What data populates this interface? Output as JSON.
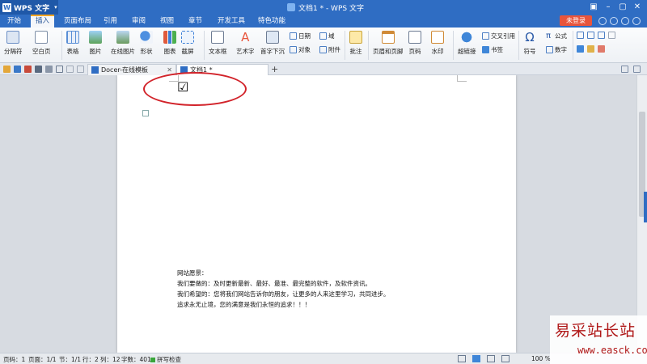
{
  "app": {
    "name": "WPS 文字",
    "window_title": "文档1 * - WPS 文字"
  },
  "menu_tabs": [
    "开始",
    "插入",
    "页面布局",
    "引用",
    "审阅",
    "视图",
    "章节",
    "开发工具",
    "特色功能"
  ],
  "active_tab": "插入",
  "login_button": "未登录",
  "ribbon": {
    "page_break": "分隔符",
    "blank_page": "空白页",
    "table": "表格",
    "picture": "图片",
    "online_picture": "在线图片",
    "shape": "形状",
    "chart": "图表",
    "screenshot": "截屏",
    "textbox": "文本框",
    "wordart": "艺术字",
    "dropcap": "首字下沉",
    "date": "日期",
    "field": "域",
    "object": "对象",
    "attachment": "附件",
    "comment": "批注",
    "header_footer": "页眉和页脚",
    "page_number": "页码",
    "watermark": "水印",
    "hyperlink": "超链接",
    "cross_ref": "交叉引用",
    "bookmark": "书签",
    "symbol": "符号",
    "formula": "公式",
    "number": "数字"
  },
  "doc_tabs": [
    {
      "label": "Docer-在线模板"
    },
    {
      "label": "文档1 *"
    }
  ],
  "document": {
    "checkbox_glyph": "☑",
    "paragraphs": [
      "网站愿景：",
      "我们要做的：及时更新最新、最好、最准、最完整的软件，及软件资讯。",
      "我们希望的：您将我们网站告诉你的朋友，让更多的人来这里学习，共同进步。",
      "追求永无止境，您的满意是我们永恒的追求！！！"
    ]
  },
  "status": {
    "page_no": "页码：1",
    "pages": "页面：1/1",
    "section": "节：1/1",
    "line": "行：2",
    "column": "列：12",
    "words": "字数：401",
    "spell": "拼写检查",
    "zoom": "100 %"
  },
  "watermark": {
    "title": "易采站长站",
    "url": "www.easck.com"
  },
  "colors": {
    "accent": "#2f6dc3",
    "login": "#e8553c",
    "annotation": "#d2232a",
    "watermark": "#b01818"
  }
}
